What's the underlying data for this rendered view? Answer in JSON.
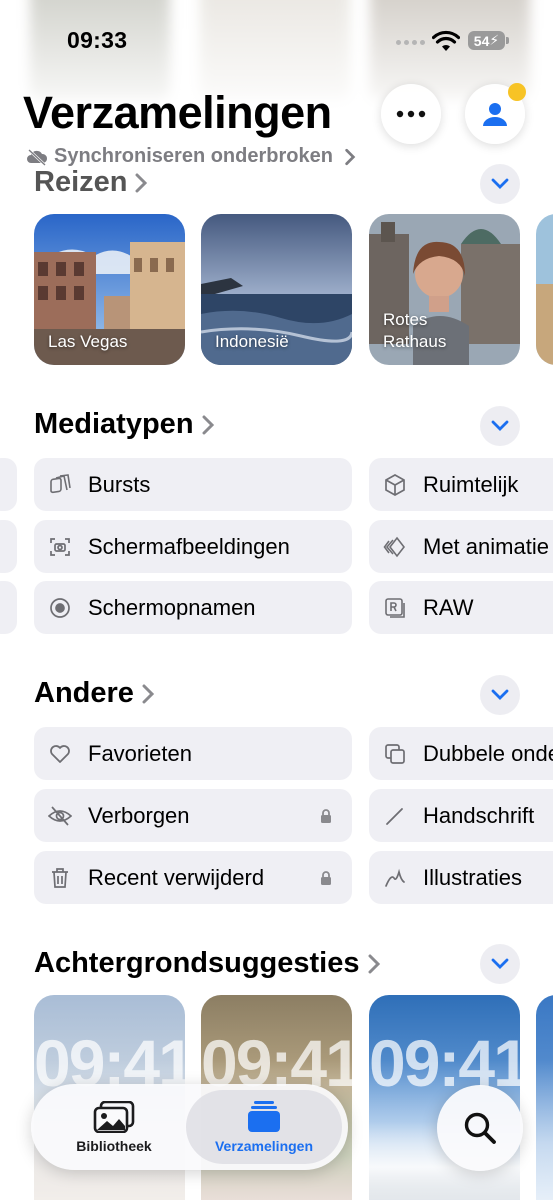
{
  "status": {
    "time": "09:33",
    "battery": "54"
  },
  "header": {
    "title": "Verzamelingen",
    "sync_status": "Synchroniseren onderbroken"
  },
  "sections": {
    "reizen": {
      "title": "Reizen",
      "cards": [
        {
          "label": "Las Vegas"
        },
        {
          "label": "Indonesië"
        },
        {
          "label": "Rotes Rathaus"
        }
      ]
    },
    "mediatypen": {
      "title": "Mediatypen",
      "items": [
        {
          "label": "Bursts",
          "icon": "bursts-icon"
        },
        {
          "label": "Ruimtelijk",
          "icon": "cube-icon"
        },
        {
          "label": "Schermafbeeldingen",
          "icon": "screenshot-icon"
        },
        {
          "label": "Met animatie",
          "icon": "animated-icon"
        },
        {
          "label": "Schermopnamen",
          "icon": "screen-recording-icon"
        },
        {
          "label": "RAW",
          "icon": "raw-icon"
        }
      ]
    },
    "andere": {
      "title": "Andere",
      "items": [
        {
          "label": "Favorieten",
          "icon": "heart-icon"
        },
        {
          "label": "Dubbele onderdelen",
          "icon": "duplicate-icon"
        },
        {
          "label": "Verborgen",
          "icon": "hidden-icon",
          "locked": true
        },
        {
          "label": "Handschrift",
          "icon": "pencil-icon"
        },
        {
          "label": "Recent verwijderd",
          "icon": "trash-icon",
          "locked": true
        },
        {
          "label": "Illustraties",
          "icon": "illustration-icon"
        }
      ]
    },
    "achtergrond": {
      "title": "Achtergrondsuggesties",
      "cards": [
        {
          "time": "09:41"
        },
        {
          "time": "09:41"
        },
        {
          "time": "09:41"
        }
      ]
    }
  },
  "tabbar": {
    "library": "Bibliotheek",
    "collections": "Verzamelingen",
    "active": "collections"
  },
  "colors": {
    "accent": "#1b6ff0",
    "notification": "#f7c325",
    "pill_bg": "#efeff4",
    "secondary_text": "#7d7d82"
  }
}
